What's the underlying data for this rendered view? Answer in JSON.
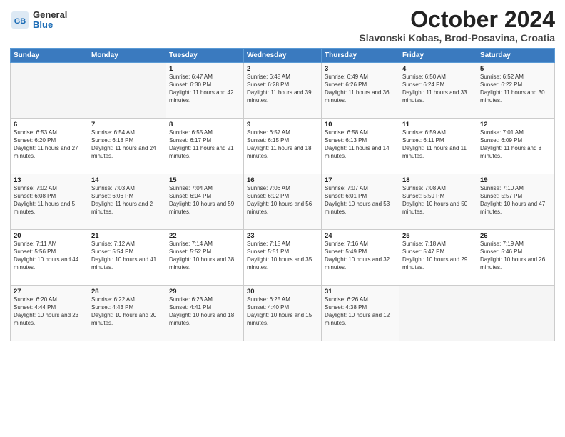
{
  "header": {
    "logo_general": "General",
    "logo_blue": "Blue",
    "title": "October 2024",
    "subtitle": "Slavonski Kobas, Brod-Posavina, Croatia"
  },
  "weekdays": [
    "Sunday",
    "Monday",
    "Tuesday",
    "Wednesday",
    "Thursday",
    "Friday",
    "Saturday"
  ],
  "weeks": [
    [
      {
        "day": "",
        "content": ""
      },
      {
        "day": "",
        "content": ""
      },
      {
        "day": "1",
        "content": "Sunrise: 6:47 AM\nSunset: 6:30 PM\nDaylight: 11 hours and 42 minutes."
      },
      {
        "day": "2",
        "content": "Sunrise: 6:48 AM\nSunset: 6:28 PM\nDaylight: 11 hours and 39 minutes."
      },
      {
        "day": "3",
        "content": "Sunrise: 6:49 AM\nSunset: 6:26 PM\nDaylight: 11 hours and 36 minutes."
      },
      {
        "day": "4",
        "content": "Sunrise: 6:50 AM\nSunset: 6:24 PM\nDaylight: 11 hours and 33 minutes."
      },
      {
        "day": "5",
        "content": "Sunrise: 6:52 AM\nSunset: 6:22 PM\nDaylight: 11 hours and 30 minutes."
      }
    ],
    [
      {
        "day": "6",
        "content": "Sunrise: 6:53 AM\nSunset: 6:20 PM\nDaylight: 11 hours and 27 minutes."
      },
      {
        "day": "7",
        "content": "Sunrise: 6:54 AM\nSunset: 6:18 PM\nDaylight: 11 hours and 24 minutes."
      },
      {
        "day": "8",
        "content": "Sunrise: 6:55 AM\nSunset: 6:17 PM\nDaylight: 11 hours and 21 minutes."
      },
      {
        "day": "9",
        "content": "Sunrise: 6:57 AM\nSunset: 6:15 PM\nDaylight: 11 hours and 18 minutes."
      },
      {
        "day": "10",
        "content": "Sunrise: 6:58 AM\nSunset: 6:13 PM\nDaylight: 11 hours and 14 minutes."
      },
      {
        "day": "11",
        "content": "Sunrise: 6:59 AM\nSunset: 6:11 PM\nDaylight: 11 hours and 11 minutes."
      },
      {
        "day": "12",
        "content": "Sunrise: 7:01 AM\nSunset: 6:09 PM\nDaylight: 11 hours and 8 minutes."
      }
    ],
    [
      {
        "day": "13",
        "content": "Sunrise: 7:02 AM\nSunset: 6:08 PM\nDaylight: 11 hours and 5 minutes."
      },
      {
        "day": "14",
        "content": "Sunrise: 7:03 AM\nSunset: 6:06 PM\nDaylight: 11 hours and 2 minutes."
      },
      {
        "day": "15",
        "content": "Sunrise: 7:04 AM\nSunset: 6:04 PM\nDaylight: 10 hours and 59 minutes."
      },
      {
        "day": "16",
        "content": "Sunrise: 7:06 AM\nSunset: 6:02 PM\nDaylight: 10 hours and 56 minutes."
      },
      {
        "day": "17",
        "content": "Sunrise: 7:07 AM\nSunset: 6:01 PM\nDaylight: 10 hours and 53 minutes."
      },
      {
        "day": "18",
        "content": "Sunrise: 7:08 AM\nSunset: 5:59 PM\nDaylight: 10 hours and 50 minutes."
      },
      {
        "day": "19",
        "content": "Sunrise: 7:10 AM\nSunset: 5:57 PM\nDaylight: 10 hours and 47 minutes."
      }
    ],
    [
      {
        "day": "20",
        "content": "Sunrise: 7:11 AM\nSunset: 5:56 PM\nDaylight: 10 hours and 44 minutes."
      },
      {
        "day": "21",
        "content": "Sunrise: 7:12 AM\nSunset: 5:54 PM\nDaylight: 10 hours and 41 minutes."
      },
      {
        "day": "22",
        "content": "Sunrise: 7:14 AM\nSunset: 5:52 PM\nDaylight: 10 hours and 38 minutes."
      },
      {
        "day": "23",
        "content": "Sunrise: 7:15 AM\nSunset: 5:51 PM\nDaylight: 10 hours and 35 minutes."
      },
      {
        "day": "24",
        "content": "Sunrise: 7:16 AM\nSunset: 5:49 PM\nDaylight: 10 hours and 32 minutes."
      },
      {
        "day": "25",
        "content": "Sunrise: 7:18 AM\nSunset: 5:47 PM\nDaylight: 10 hours and 29 minutes."
      },
      {
        "day": "26",
        "content": "Sunrise: 7:19 AM\nSunset: 5:46 PM\nDaylight: 10 hours and 26 minutes."
      }
    ],
    [
      {
        "day": "27",
        "content": "Sunrise: 6:20 AM\nSunset: 4:44 PM\nDaylight: 10 hours and 23 minutes."
      },
      {
        "day": "28",
        "content": "Sunrise: 6:22 AM\nSunset: 4:43 PM\nDaylight: 10 hours and 20 minutes."
      },
      {
        "day": "29",
        "content": "Sunrise: 6:23 AM\nSunset: 4:41 PM\nDaylight: 10 hours and 18 minutes."
      },
      {
        "day": "30",
        "content": "Sunrise: 6:25 AM\nSunset: 4:40 PM\nDaylight: 10 hours and 15 minutes."
      },
      {
        "day": "31",
        "content": "Sunrise: 6:26 AM\nSunset: 4:38 PM\nDaylight: 10 hours and 12 minutes."
      },
      {
        "day": "",
        "content": ""
      },
      {
        "day": "",
        "content": ""
      }
    ]
  ]
}
